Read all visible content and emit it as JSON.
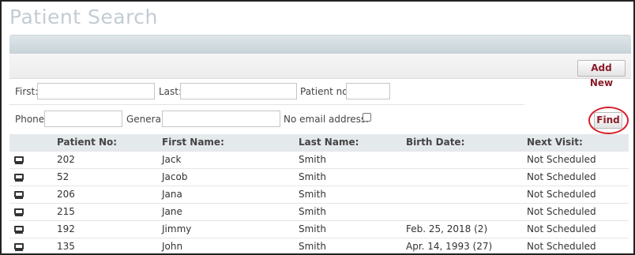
{
  "page_title": "Patient Search",
  "toolbar": {
    "add_new_label": "Add New"
  },
  "search": {
    "first_label": "First:",
    "last_label": "Last:",
    "patient_no_label": "Patient no:",
    "phone_label": "Phone:",
    "general_label": "General:",
    "no_email_label": "No email address:",
    "find_label": "Find",
    "first_value": "",
    "last_value": "",
    "patient_no_value": "",
    "phone_value": "",
    "general_value": "",
    "no_email_checked": false
  },
  "table": {
    "headers": [
      "Patient No:",
      "First Name:",
      "Last Name:",
      "Birth Date:",
      "Next Visit:"
    ],
    "row_icon": "monitor-icon",
    "rows": [
      {
        "no": "202",
        "first": "Jack",
        "last": "Smith",
        "birth": "",
        "next": "Not Scheduled"
      },
      {
        "no": "52",
        "first": "Jacob",
        "last": "Smith",
        "birth": "",
        "next": "Not Scheduled"
      },
      {
        "no": "206",
        "first": "Jana",
        "last": "Smith",
        "birth": "",
        "next": "Not Scheduled"
      },
      {
        "no": "215",
        "first": "Jane",
        "last": "Smith",
        "birth": "",
        "next": "Not Scheduled"
      },
      {
        "no": "192",
        "first": "Jimmy",
        "last": "Smith",
        "birth": "Feb. 25, 2018 (2)",
        "next": "Not Scheduled"
      },
      {
        "no": "135",
        "first": "John",
        "last": "Smith",
        "birth": "Apr. 14, 1993 (27)",
        "next": "Not Scheduled"
      }
    ]
  },
  "colors": {
    "accent_button_text": "#8a1d2b",
    "highlight_circle": "#d81f2a",
    "title": "#c3ccd3"
  }
}
